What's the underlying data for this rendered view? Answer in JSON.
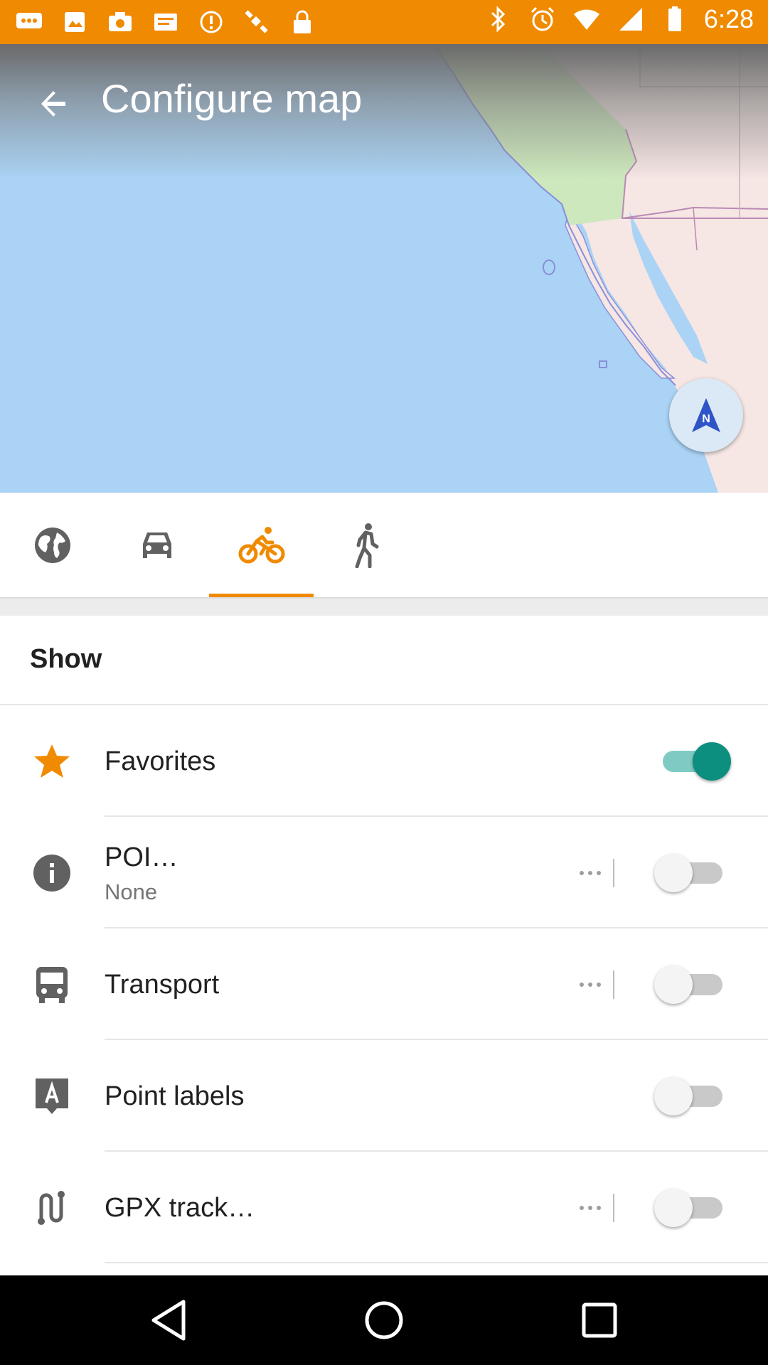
{
  "status_bar": {
    "time": "6:28",
    "background_color": "#f08a00",
    "left_icons": [
      "chat-icon",
      "image-icon",
      "camera-icon",
      "message-icon",
      "alert-icon",
      "satellite-icon",
      "lock-icon"
    ],
    "right_icons": [
      "bluetooth-icon",
      "alarm-icon",
      "wifi-icon",
      "signal-icon",
      "battery-icon"
    ]
  },
  "header": {
    "title": "Configure map",
    "back_icon": "arrow-back-icon"
  },
  "map": {
    "water_color": "#aad3f5",
    "land_color": "#f6e6e4",
    "park_color": "#cde8bd",
    "compass_label": "N"
  },
  "profile_tabs": {
    "active_index": 2,
    "accent_color": "#f08a00",
    "items": [
      {
        "icon": "globe-icon"
      },
      {
        "icon": "car-icon"
      },
      {
        "icon": "bicycle-icon"
      },
      {
        "icon": "pedestrian-icon"
      }
    ]
  },
  "show_section": {
    "title": "Show",
    "items": [
      {
        "label": "Favorites",
        "sublabel": "",
        "icon": "star-icon",
        "enabled": true,
        "has_more": false
      },
      {
        "label": "POI…",
        "sublabel": "None",
        "icon": "info-icon",
        "enabled": false,
        "has_more": true
      },
      {
        "label": "Transport",
        "sublabel": "",
        "icon": "bus-icon",
        "enabled": false,
        "has_more": true
      },
      {
        "label": "Point labels",
        "sublabel": "",
        "icon": "label-icon",
        "enabled": false,
        "has_more": false
      },
      {
        "label": "GPX track…",
        "sublabel": "",
        "icon": "route-icon",
        "enabled": false,
        "has_more": true
      }
    ]
  },
  "toggle_on_color": "#0d8f80",
  "navigation_bar": {
    "buttons": [
      "back-nav-icon",
      "home-nav-icon",
      "recents-nav-icon"
    ]
  }
}
